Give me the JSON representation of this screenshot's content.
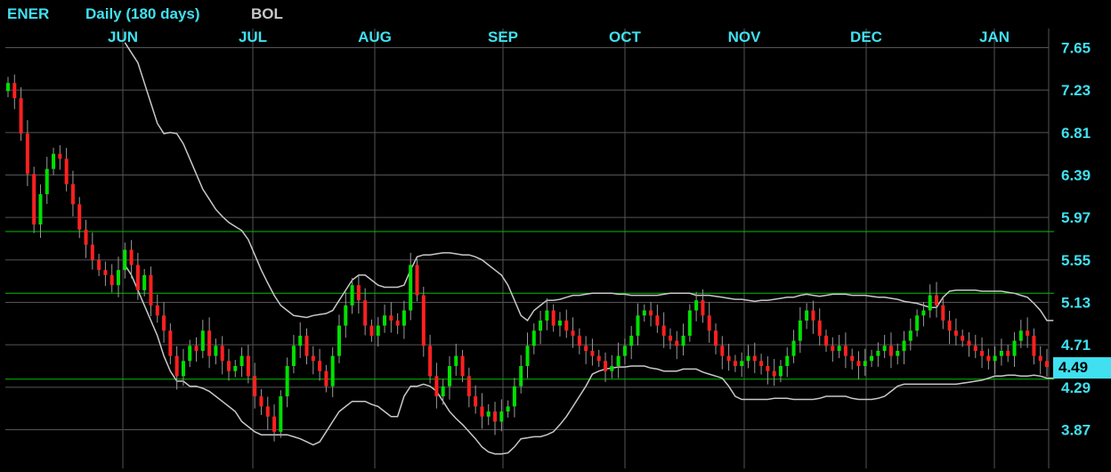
{
  "header": {
    "symbol": "ENER",
    "period": "Daily (180 days)",
    "study": "BOL"
  },
  "colors": {
    "background": "#000000",
    "axis_text": "#40e0f0",
    "up_candle": "#00e000",
    "down_candle": "#ff2020",
    "bands": "#c8c8c8",
    "grid": "#555555",
    "hlines": "#00c000",
    "price_tag_bg": "#40e0f0",
    "price_tag_text": "#000000"
  },
  "chart_data": {
    "type": "candlestick",
    "ylim": [
      3.7,
      7.8
    ],
    "y_ticks": [
      "7.65",
      "7.23",
      "6.81",
      "6.39",
      "5.97",
      "5.55",
      "5.13",
      "4.71",
      "4.29",
      "3.87"
    ],
    "x_labels": [
      "JUN",
      "JUL",
      "AUG",
      "SEP",
      "OCT",
      "NOV",
      "DEC",
      "JAN"
    ],
    "last_price": "4.49",
    "horizontal_lines": [
      5.83,
      5.22,
      4.37
    ],
    "grid": true,
    "closes": [
      7.3,
      7.15,
      6.8,
      6.4,
      5.9,
      6.2,
      6.45,
      6.6,
      6.55,
      6.3,
      6.1,
      5.85,
      5.7,
      5.55,
      5.45,
      5.4,
      5.3,
      5.45,
      5.65,
      5.5,
      5.25,
      5.4,
      5.1,
      5.0,
      4.85,
      4.6,
      4.4,
      4.55,
      4.7,
      4.65,
      4.85,
      4.6,
      4.7,
      4.55,
      4.45,
      4.5,
      4.6,
      4.4,
      4.2,
      4.1,
      4.0,
      3.85,
      4.2,
      4.5,
      4.7,
      4.8,
      4.6,
      4.55,
      4.45,
      4.3,
      4.6,
      4.9,
      5.1,
      5.3,
      5.15,
      4.9,
      4.8,
      4.9,
      5.0,
      4.95,
      4.9,
      5.05,
      5.5,
      5.2,
      4.7,
      4.4,
      4.2,
      4.3,
      4.5,
      4.6,
      4.4,
      4.2,
      4.1,
      4.0,
      4.05,
      3.95,
      4.05,
      4.1,
      4.3,
      4.5,
      4.7,
      4.85,
      4.95,
      5.05,
      4.9,
      4.95,
      4.85,
      4.8,
      4.7,
      4.65,
      4.6,
      4.55,
      4.45,
      4.5,
      4.6,
      4.7,
      4.8,
      5.0,
      5.05,
      5.0,
      4.9,
      4.8,
      4.75,
      4.7,
      4.8,
      5.05,
      5.15,
      5.0,
      4.85,
      4.7,
      4.6,
      4.55,
      4.5,
      4.55,
      4.6,
      4.55,
      4.5,
      4.45,
      4.4,
      4.5,
      4.6,
      4.75,
      4.95,
      5.05,
      4.95,
      4.8,
      4.7,
      4.65,
      4.7,
      4.6,
      4.55,
      4.5,
      4.55,
      4.6,
      4.65,
      4.7,
      4.6,
      4.65,
      4.75,
      4.85,
      5.0,
      5.05,
      5.2,
      5.1,
      4.95,
      4.85,
      4.8,
      4.75,
      4.7,
      4.65,
      4.6,
      4.55,
      4.6,
      4.65,
      4.6,
      4.75,
      4.85,
      4.8,
      4.6,
      4.55,
      4.49
    ],
    "upper_band": [
      null,
      null,
      null,
      null,
      null,
      null,
      null,
      null,
      null,
      null,
      null,
      null,
      null,
      null,
      null,
      null,
      null,
      null,
      7.7,
      7.6,
      7.5,
      7.3,
      7.1,
      6.9,
      6.8,
      6.81,
      6.8,
      6.7,
      6.55,
      6.4,
      6.25,
      6.15,
      6.05,
      5.98,
      5.92,
      5.88,
      5.84,
      5.75,
      5.6,
      5.45,
      5.32,
      5.2,
      5.1,
      5.05,
      5.0,
      4.99,
      4.98,
      5.0,
      5.01,
      5.02,
      5.05,
      5.15,
      5.25,
      5.35,
      5.4,
      5.4,
      5.35,
      5.3,
      5.28,
      5.28,
      5.28,
      5.3,
      5.45,
      5.58,
      5.6,
      5.6,
      5.61,
      5.62,
      5.62,
      5.61,
      5.6,
      5.6,
      5.58,
      5.55,
      5.5,
      5.45,
      5.4,
      5.3,
      5.15,
      5.0,
      4.95,
      5.05,
      5.1,
      5.15,
      5.15,
      5.16,
      5.18,
      5.2,
      5.2,
      5.21,
      5.22,
      5.22,
      5.22,
      5.22,
      5.21,
      5.21,
      5.2,
      5.2,
      5.2,
      5.2,
      5.2,
      5.21,
      5.22,
      5.22,
      5.22,
      5.22,
      5.2,
      5.2,
      5.2,
      5.19,
      5.18,
      5.17,
      5.16,
      5.16,
      5.15,
      5.14,
      5.15,
      5.15,
      5.16,
      5.17,
      5.18,
      5.18,
      5.2,
      5.21,
      5.2,
      5.19,
      5.2,
      5.21,
      5.21,
      5.21,
      5.2,
      5.2,
      5.2,
      5.19,
      5.18,
      5.18,
      5.17,
      5.16,
      5.14,
      5.13,
      5.12,
      5.1,
      5.08,
      5.08,
      5.18,
      5.24,
      5.25,
      5.25,
      5.25,
      5.25,
      5.24,
      5.24,
      5.24,
      5.24,
      5.23,
      5.22,
      5.2,
      5.18,
      5.12,
      5.05,
      4.95,
      4.95
    ],
    "lower_band": [
      null,
      null,
      null,
      null,
      null,
      null,
      null,
      null,
      null,
      null,
      null,
      null,
      null,
      null,
      null,
      null,
      null,
      null,
      5.5,
      5.4,
      5.25,
      5.1,
      4.95,
      4.8,
      4.6,
      4.45,
      4.35,
      4.35,
      4.3,
      4.3,
      4.28,
      4.25,
      4.2,
      4.15,
      4.1,
      4.05,
      3.95,
      3.9,
      3.85,
      3.82,
      3.82,
      3.82,
      3.82,
      3.82,
      3.8,
      3.78,
      3.75,
      3.72,
      3.75,
      3.85,
      3.95,
      4.05,
      4.1,
      4.15,
      4.15,
      4.15,
      4.12,
      4.1,
      4.05,
      4.0,
      4.0,
      4.2,
      4.3,
      4.3,
      4.32,
      4.3,
      4.25,
      4.15,
      4.05,
      3.98,
      3.92,
      3.85,
      3.78,
      3.7,
      3.65,
      3.63,
      3.63,
      3.64,
      3.7,
      3.78,
      3.79,
      3.8,
      3.8,
      3.82,
      3.85,
      3.92,
      4.0,
      4.1,
      4.2,
      4.3,
      4.42,
      4.45,
      4.47,
      4.48,
      4.49,
      4.49,
      4.5,
      4.5,
      4.5,
      4.48,
      4.47,
      4.45,
      4.45,
      4.45,
      4.47,
      4.47,
      4.47,
      4.44,
      4.42,
      4.4,
      4.38,
      4.3,
      4.2,
      4.17,
      4.17,
      4.17,
      4.17,
      4.17,
      4.18,
      4.18,
      4.18,
      4.17,
      4.17,
      4.17,
      4.17,
      4.18,
      4.2,
      4.2,
      4.2,
      4.2,
      4.18,
      4.17,
      4.17,
      4.17,
      4.18,
      4.2,
      4.25,
      4.3,
      4.32,
      4.32,
      4.32,
      4.32,
      4.32,
      4.32,
      4.32,
      4.32,
      4.32,
      4.33,
      4.34,
      4.35,
      4.36,
      4.38,
      4.4,
      4.4,
      4.41,
      4.41,
      4.4,
      4.4,
      4.41,
      4.4,
      4.38,
      4.38,
      4.39
    ]
  }
}
